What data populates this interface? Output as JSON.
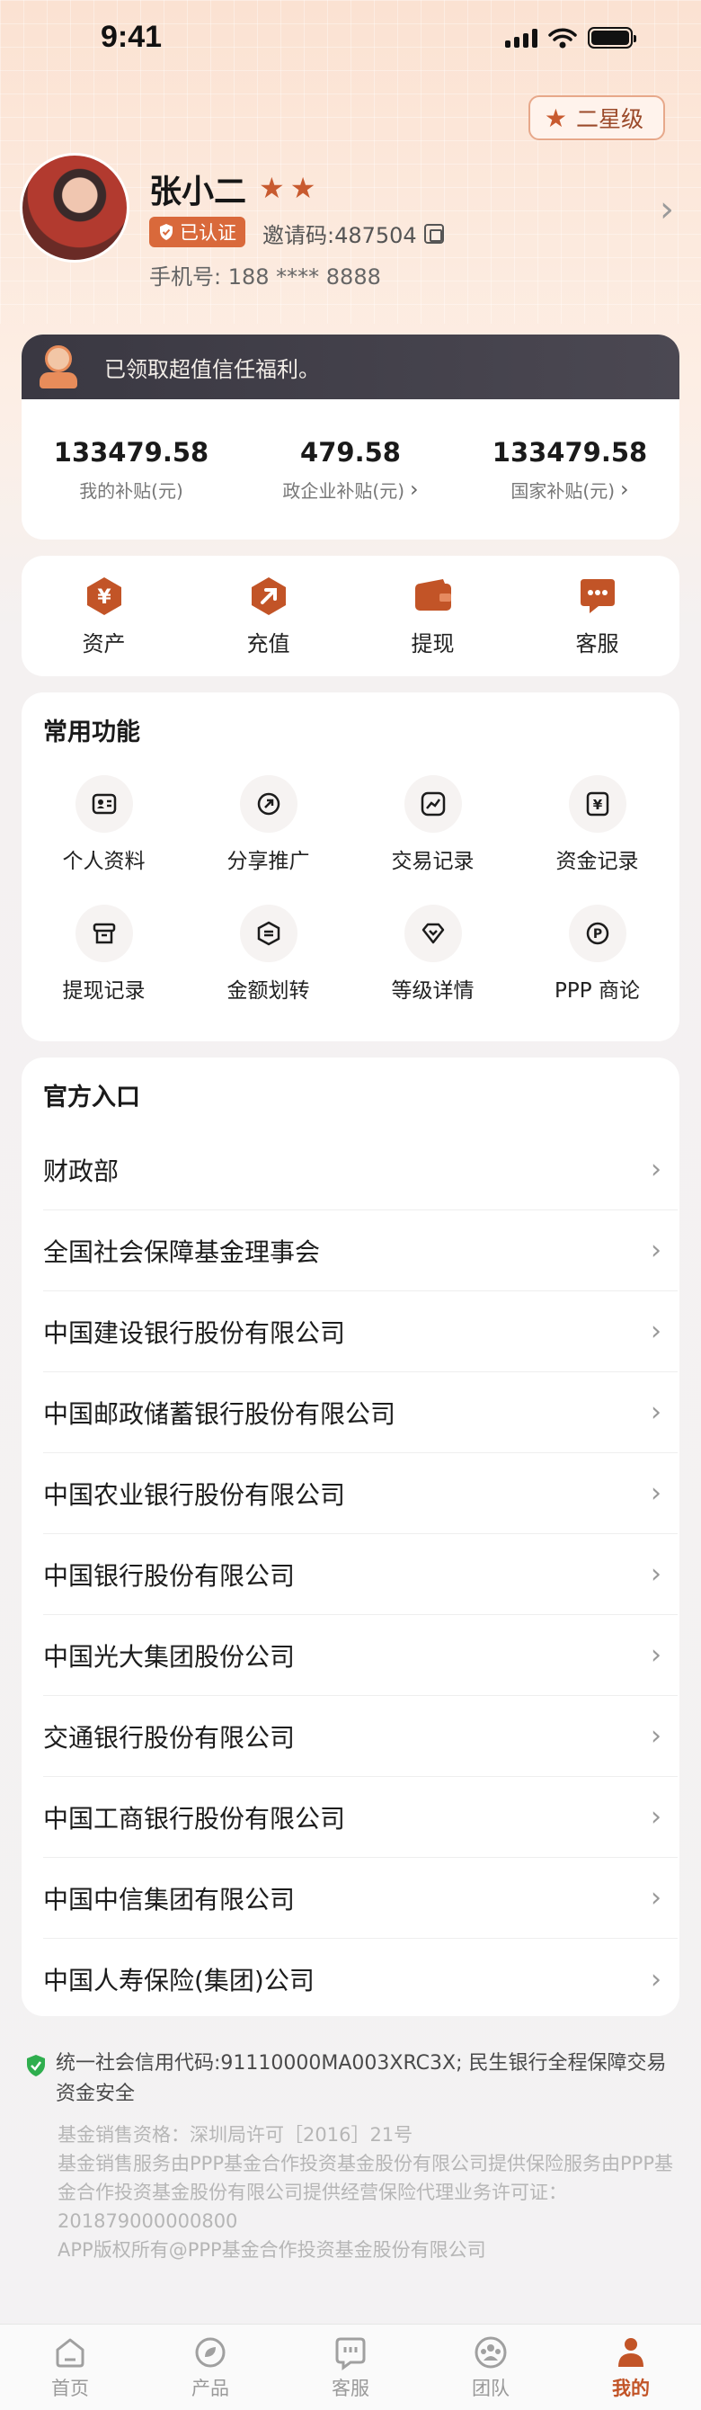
{
  "status_bar": {
    "time": "9:41"
  },
  "profile": {
    "level_badge": "二星级",
    "name": "张小二",
    "star_count": 2,
    "verified": "已认证",
    "invite_code": "邀请码:487504",
    "phone": "手机号: 188 **** 8888"
  },
  "subsidy": {
    "banner": "已领取超值信任福利。",
    "stats": [
      {
        "value": "133479.58",
        "label": "我的补贴(元)"
      },
      {
        "value": "479.58",
        "label": "政企业补贴(元)"
      },
      {
        "value": "133479.58",
        "label": "国家补贴(元)"
      }
    ]
  },
  "quick_actions": [
    {
      "label": "资产",
      "icon": "asset-icon"
    },
    {
      "label": "充值",
      "icon": "recharge-icon"
    },
    {
      "label": "提现",
      "icon": "wallet-icon"
    },
    {
      "label": "客服",
      "icon": "chat-icon"
    }
  ],
  "common": {
    "title": "常用功能",
    "items": [
      {
        "label": "个人资料",
        "icon": "id-card-icon"
      },
      {
        "label": "分享推广",
        "icon": "share-icon"
      },
      {
        "label": "交易记录",
        "icon": "chart-icon"
      },
      {
        "label": "资金记录",
        "icon": "yuan-icon"
      },
      {
        "label": "提现记录",
        "icon": "withdraw-icon"
      },
      {
        "label": "金额划转",
        "icon": "transfer-icon"
      },
      {
        "label": "等级详情",
        "icon": "diamond-icon"
      },
      {
        "label": "PPP 商论",
        "icon": "p-coin-icon"
      }
    ]
  },
  "official": {
    "title": "官方入口",
    "items": [
      "财政部",
      "全国社会保障基金理事会",
      "中国建设银行股份有限公司",
      "中国邮政储蓄银行股份有限公司",
      "中国农业银行股份有限公司",
      "中国银行股份有限公司",
      "中国光大集团股份公司",
      "交通银行股份有限公司",
      "中国工商银行股份有限公司",
      "中国中信集团有限公司",
      "中国人寿保险(集团)公司"
    ]
  },
  "footer": {
    "credit": "统一社会信用代码:91110000MA003XRC3X; 民生银行全程保障交易资金安全",
    "legal": [
      "基金销售资格：深圳局许可［2016］21号",
      "基金销售服务由PPP基金合作投资基金股份有限公司提供保险服务由PPP基金合作投资基金股份有限公司提供经营保险代理业务许可证：201879000000800",
      "APP版权所有@PPP基金合作投资基金股份有限公司"
    ]
  },
  "tabbar": [
    {
      "label": "首页",
      "icon": "home-icon",
      "active": false
    },
    {
      "label": "产品",
      "icon": "product-icon",
      "active": false
    },
    {
      "label": "客服",
      "icon": "service-icon",
      "active": false
    },
    {
      "label": "团队",
      "icon": "team-icon",
      "active": false
    },
    {
      "label": "我的",
      "icon": "profile-icon",
      "active": true
    }
  ],
  "colors": {
    "accent": "#c85a2f",
    "badge": "#d9693b",
    "banner": "#3f3c46"
  }
}
